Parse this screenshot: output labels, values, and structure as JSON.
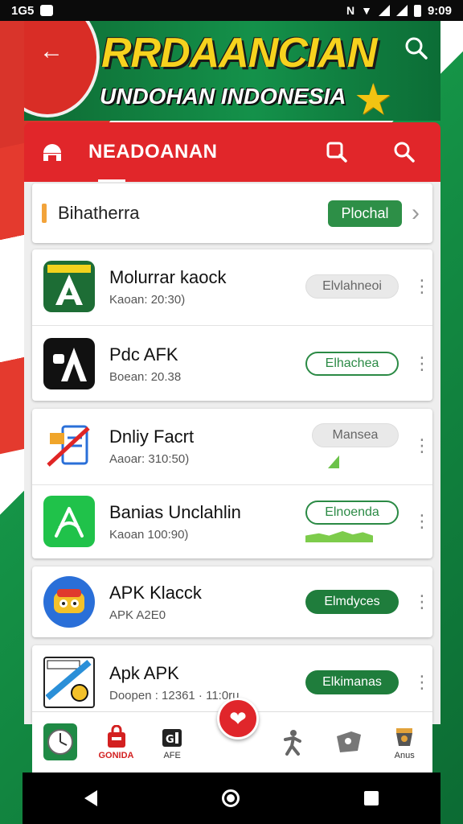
{
  "status_bar": {
    "time_left": "1G5",
    "time_right": "9:09"
  },
  "banner": {
    "title": "RRDAANCIAN",
    "subtitle": "UNDOHAN INDONESIA"
  },
  "toolbar": {
    "title": "NEADOANAN"
  },
  "filter": {
    "label": "Bihatherra",
    "button": "Plochal"
  },
  "apps": [
    {
      "name": "Molurrar kaock",
      "meta": "Kaoan: 20:30)",
      "action": "Elvlahneoi",
      "style": "grey"
    },
    {
      "name": "Pdc AFK",
      "meta": "Boean: 20.38",
      "action": "Elhachea",
      "style": "outline"
    },
    {
      "name": "Dnliy Facrt",
      "meta": "Aaoar: 310:50)",
      "action": "Mansea",
      "style": "grey"
    },
    {
      "name": "Banias Unclahlin",
      "meta": "Kaoan 100:90)",
      "action": "Elnoenda",
      "style": "outline"
    },
    {
      "name": "APK Klacck",
      "meta": "APK A2E0",
      "action": "Elmdyces",
      "style": "filled"
    },
    {
      "name": "Apk APK",
      "meta": "Doopen : 12361 · 11:0ru",
      "action": "Elkimanas",
      "style": "filled"
    }
  ],
  "bottom_nav": {
    "items": [
      {
        "label": ""
      },
      {
        "label": "GONIDA"
      },
      {
        "label": "AFE"
      },
      {
        "label": ""
      },
      {
        "label": ""
      },
      {
        "label": "Anus"
      }
    ]
  },
  "colors": {
    "primary_red": "#e1262a",
    "primary_green": "#1f7d3c",
    "accent_yellow": "#f7d21e"
  }
}
